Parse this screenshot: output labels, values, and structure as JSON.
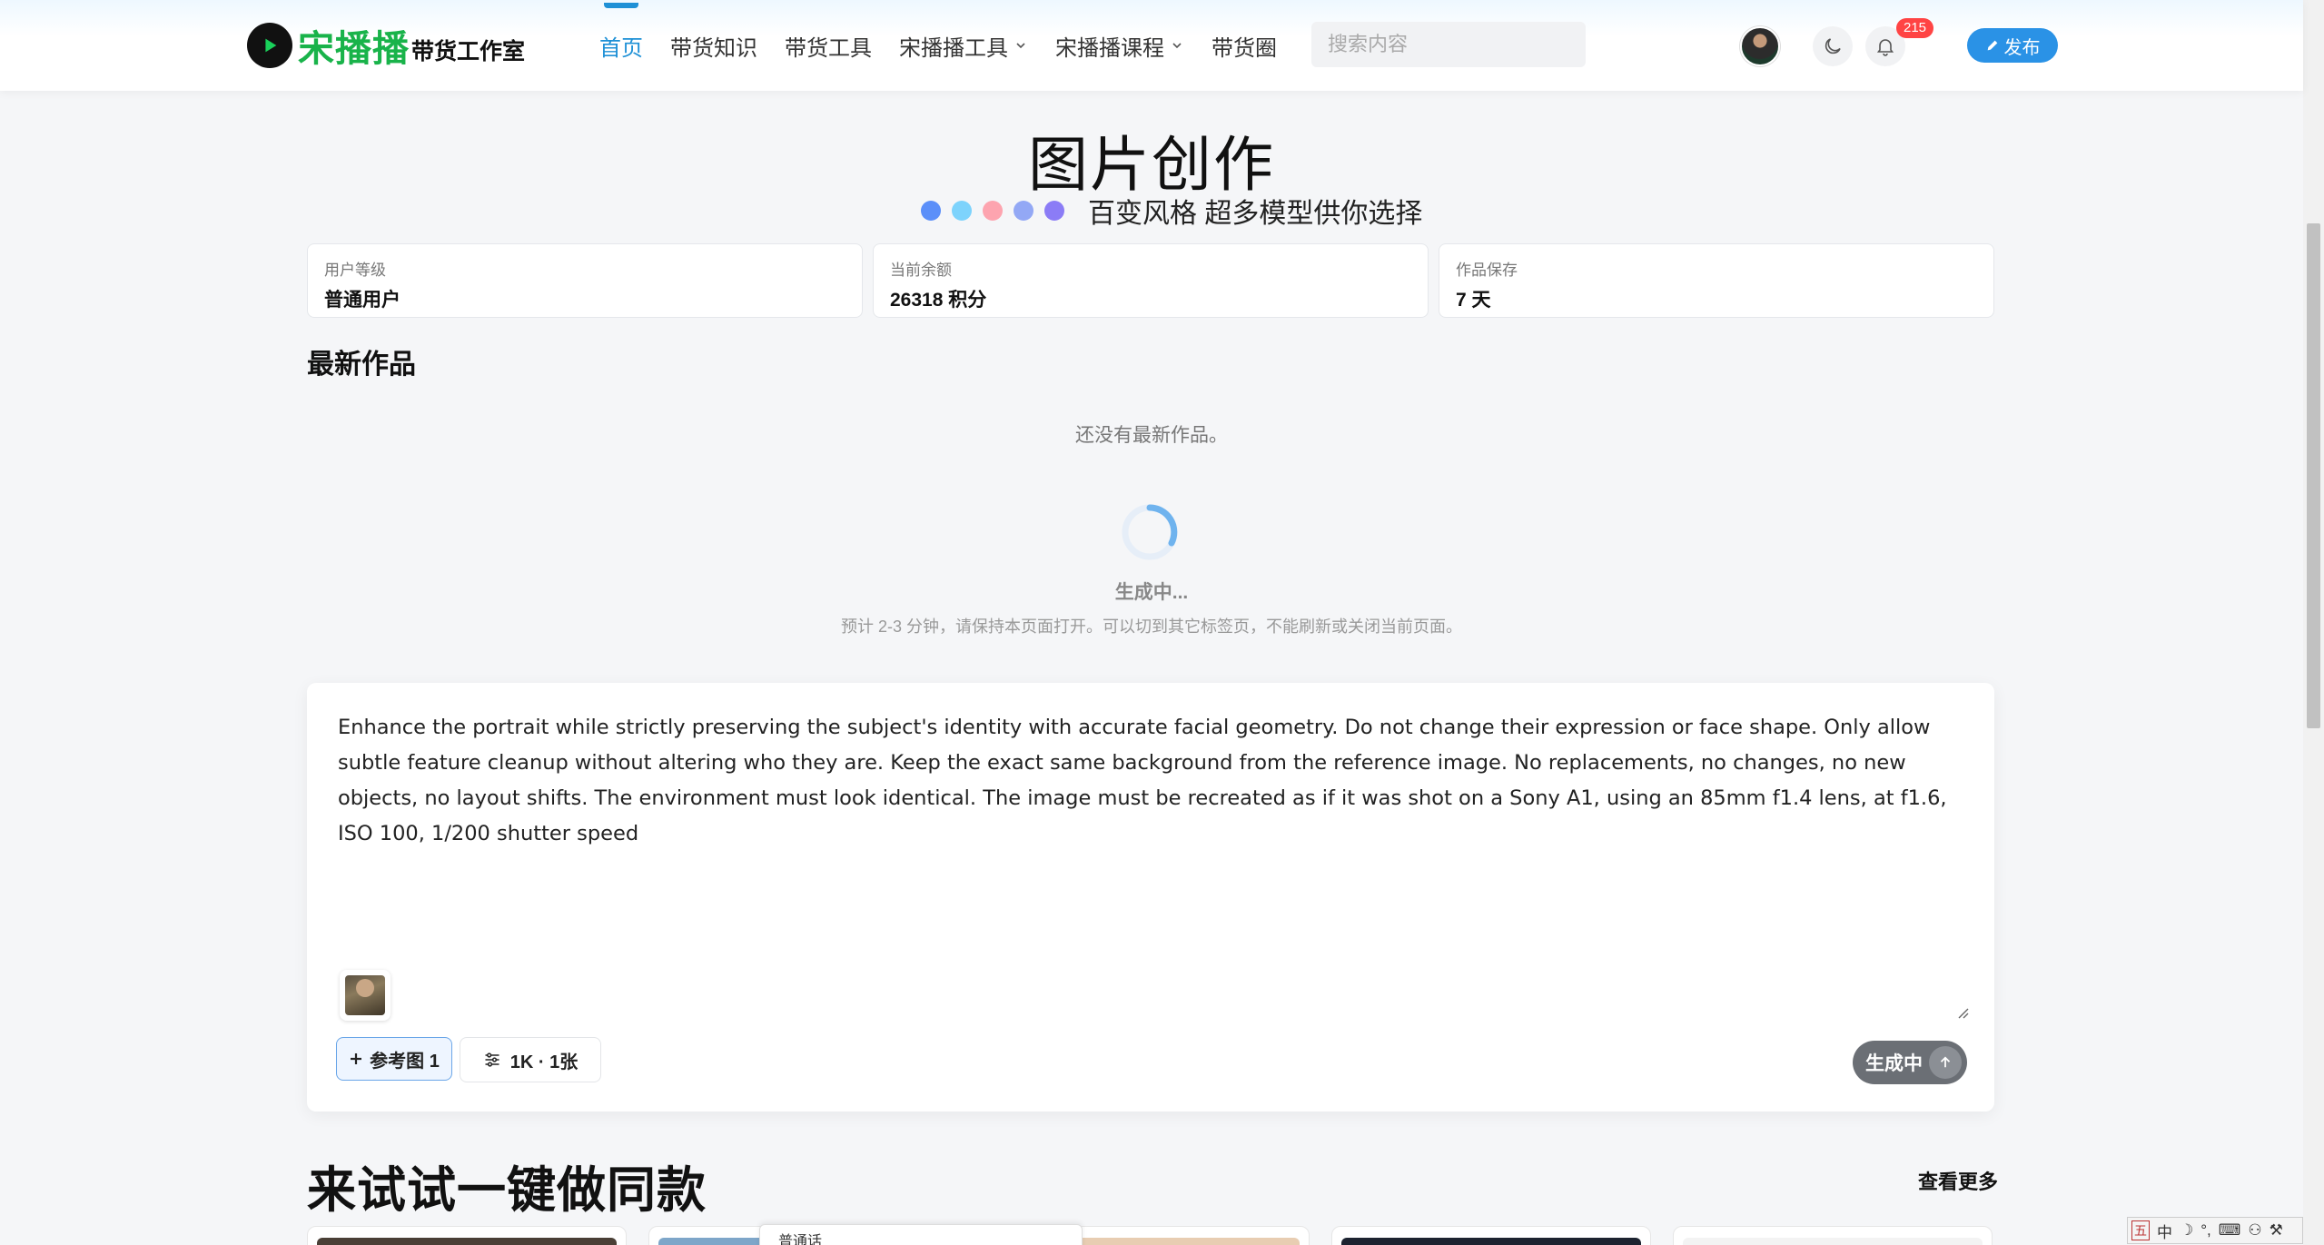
{
  "header": {
    "logo_main": "宋播播",
    "logo_sub": "带货工作室",
    "nav": [
      {
        "label": "首页",
        "active": true,
        "dropdown": false
      },
      {
        "label": "带货知识",
        "active": false,
        "dropdown": false
      },
      {
        "label": "带货工具",
        "active": false,
        "dropdown": false
      },
      {
        "label": "宋播播工具",
        "active": false,
        "dropdown": true
      },
      {
        "label": "宋播播课程",
        "active": false,
        "dropdown": true
      },
      {
        "label": "带货圈",
        "active": false,
        "dropdown": false
      }
    ],
    "search_placeholder": "搜索内容",
    "notification_count": "215",
    "publish_label": "发布"
  },
  "hero": {
    "title": "图片创作",
    "subtitle": "百变风格 超多模型供你选择",
    "dot_colors": [
      "#5b8ff9",
      "#7dd3fc",
      "#fda4af",
      "#93a8f5",
      "#8b7cf6"
    ]
  },
  "stats": [
    {
      "label": "用户等级",
      "value": "普通用户"
    },
    {
      "label": "当前余额",
      "value": "26318 积分"
    },
    {
      "label": "作品保存",
      "value": "7 天"
    }
  ],
  "latest": {
    "title": "最新作品",
    "empty": "还没有最新作品。",
    "status": "生成中...",
    "hint": "预计 2-3 分钟，请保持本页面打开。可以切到其它标签页，不能刷新或关闭当前页面。"
  },
  "prompt": {
    "text": "Enhance the portrait while strictly preserving the subject's identity with accurate facial geometry. Do not change their expression or face shape. Only allow subtle feature cleanup without altering who they are. Keep the exact same background from the reference image. No replacements, no changes, no new objects, no layout shifts. The environment must look identical. The image must be recreated as if it was shot on a Sony A1, using an 85mm f1.4 lens, at f1.6, ISO 100, 1/200 shutter speed",
    "ref_button": "参考图 1",
    "options_button": "1K · 1张",
    "generate_button": "生成中"
  },
  "try_same": {
    "title": "来试试一键做同款",
    "see_more": "查看更多"
  },
  "mini_player": {
    "label": "普通话"
  },
  "ime": {
    "wu": "五",
    "lang": "中"
  },
  "colors": {
    "accent": "#1e90d6",
    "brand_green": "#19b34a",
    "publish": "#2a92e6",
    "badge": "#ff4444"
  }
}
